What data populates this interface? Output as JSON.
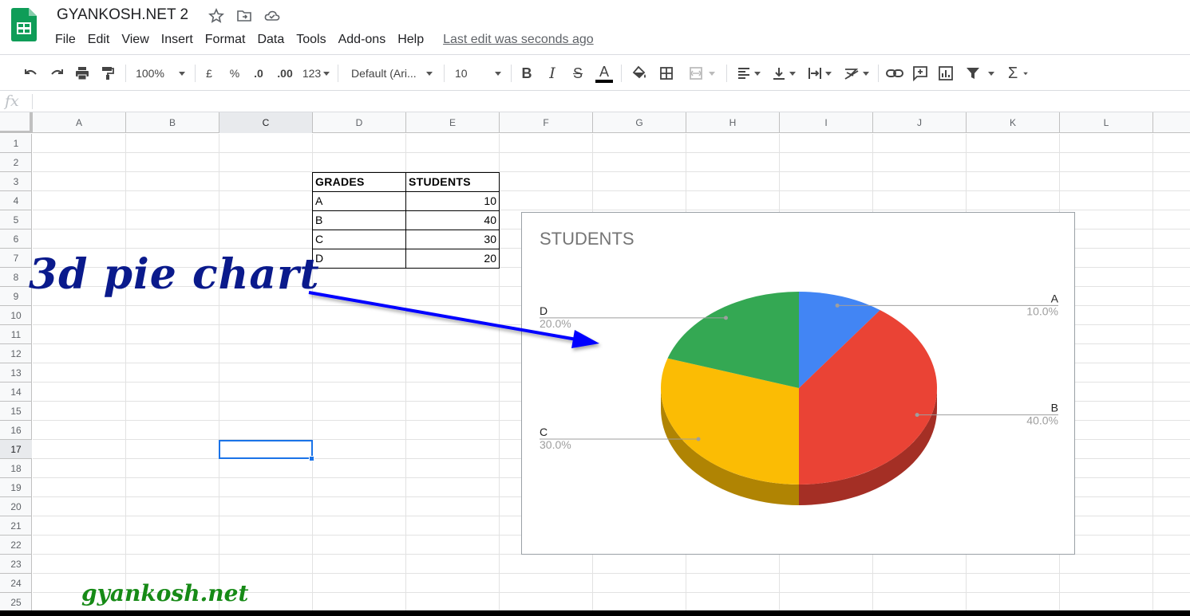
{
  "app": {
    "doc_title": "GYANKOSH.NET 2",
    "menu": [
      "File",
      "Edit",
      "View",
      "Insert",
      "Format",
      "Data",
      "Tools",
      "Add-ons",
      "Help"
    ],
    "last_edit": "Last edit was seconds ago"
  },
  "toolbar": {
    "zoom": "100%",
    "currency": "£",
    "percent": "%",
    "decimal_decrease": ".0",
    "decimal_increase": ".00",
    "more_formats": "123",
    "font": "Default (Ari...",
    "font_size": "10",
    "bold": "B",
    "italic": "I",
    "strike": "S",
    "text_color_letter": "A",
    "text_color": "#000000"
  },
  "formula_bar": {
    "fx": "fx"
  },
  "grid": {
    "columns": [
      "A",
      "B",
      "C",
      "D",
      "E",
      "F",
      "G",
      "H",
      "I",
      "J",
      "K",
      "L"
    ],
    "rows": [
      "1",
      "2",
      "3",
      "4",
      "5",
      "6",
      "7",
      "8",
      "9",
      "10",
      "11",
      "12",
      "13",
      "14",
      "15",
      "16",
      "17",
      "18",
      "19",
      "20",
      "21",
      "22",
      "23",
      "24",
      "25"
    ],
    "active_column": "C",
    "active_row": "17"
  },
  "table": {
    "headers": [
      "GRADES",
      "STUDENTS"
    ],
    "rows": [
      [
        "A",
        "10"
      ],
      [
        "B",
        "40"
      ],
      [
        "C",
        "30"
      ],
      [
        "D",
        "20"
      ]
    ]
  },
  "chart_data": {
    "type": "pie",
    "style": "3d",
    "title": "STUDENTS",
    "categories": [
      "A",
      "B",
      "C",
      "D"
    ],
    "values": [
      10,
      40,
      30,
      20
    ],
    "percent_labels": [
      "10.0%",
      "40.0%",
      "30.0%",
      "20.0%"
    ],
    "colors": [
      "#4285f4",
      "#ea4335",
      "#fbbc04",
      "#34a853"
    ],
    "legend": "labeled"
  },
  "annotations": {
    "headline": "3d pie chart",
    "watermark": "gyankosh.net",
    "arrow_color": "#0000ff"
  },
  "colors": {
    "selection": "#1a73e8",
    "sheets_green": "#0f9d58"
  }
}
